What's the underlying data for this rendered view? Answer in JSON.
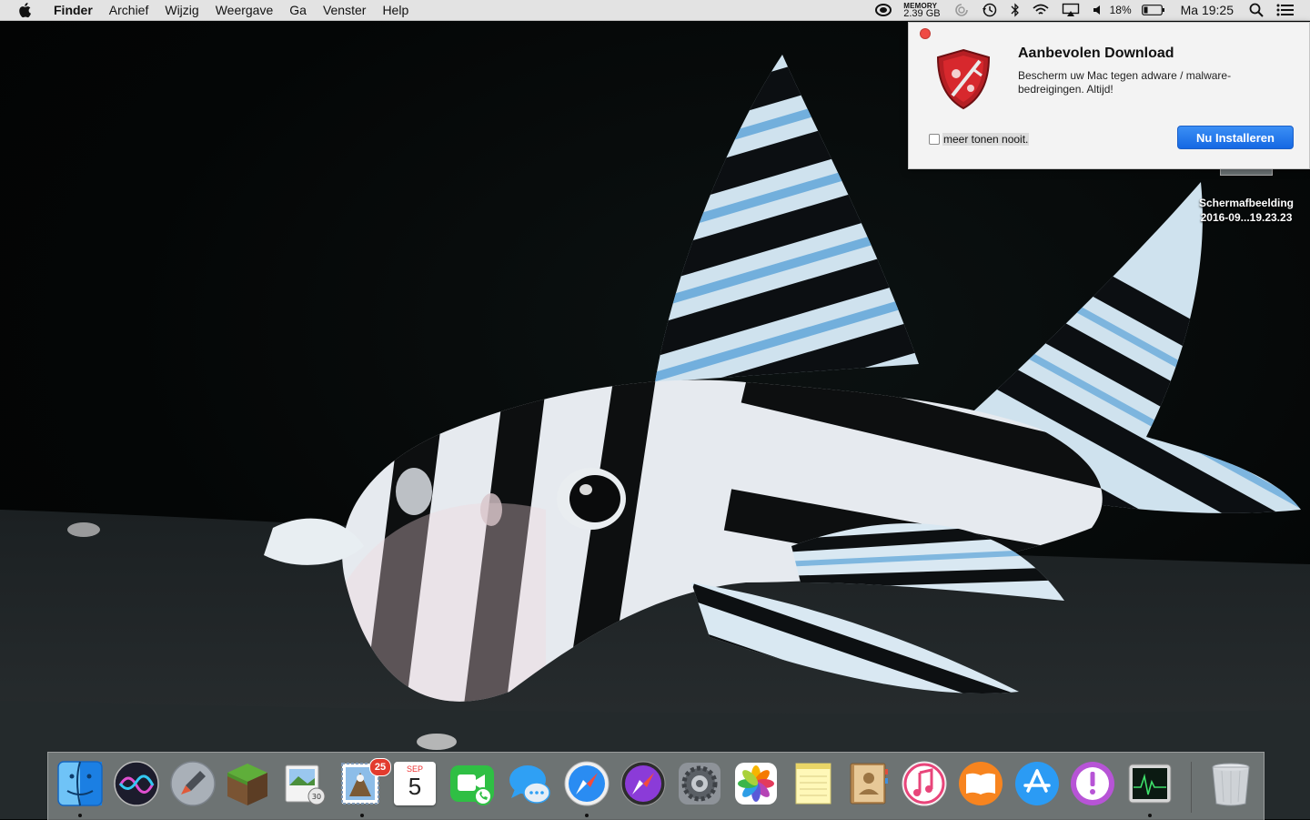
{
  "menubar": {
    "items": [
      "Finder",
      "Archief",
      "Wijzig",
      "Weergave",
      "Ga",
      "Venster",
      "Help"
    ],
    "memory_label": "MEMORY",
    "memory_value": "2.39 GB",
    "battery_percent": "18%",
    "clock": "Ma 19:25"
  },
  "popup": {
    "title": "Aanbevolen Download",
    "body": "Bescherm uw Mac tegen adware / malware-bedreigingen. Altijd!",
    "checkbox_label": "meer tonen nooit.",
    "checkbox_checked": false,
    "button_label": "Nu Installeren"
  },
  "desktop_file": {
    "name_line1": "Schermafbeelding",
    "name_line2": "2016-09...19.23.23"
  },
  "dock": {
    "mail_badge": "25",
    "calendar_month": "SEP",
    "calendar_day": "5"
  }
}
